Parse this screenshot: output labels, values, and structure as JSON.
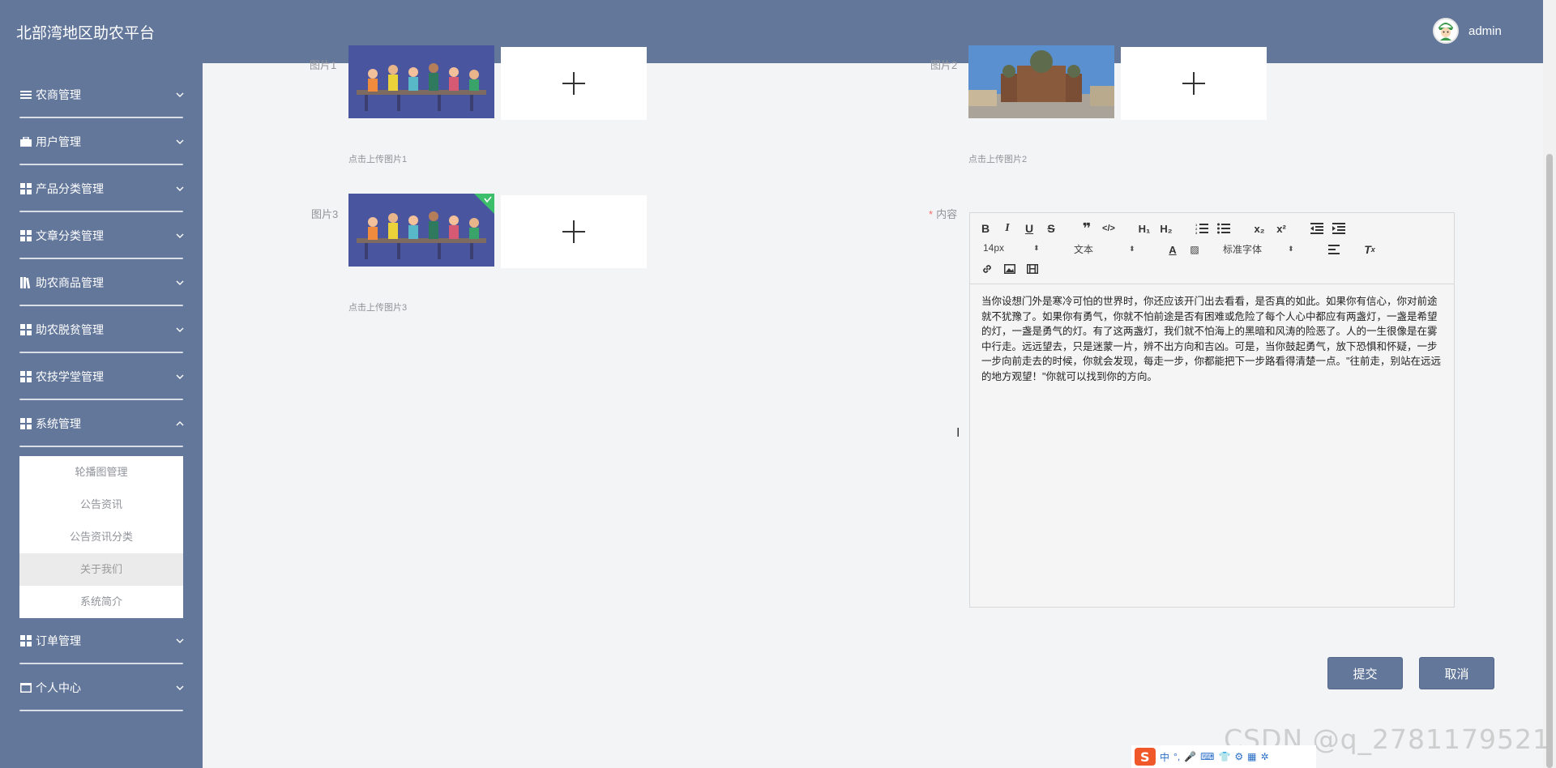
{
  "header": {
    "title": "北部湾地区助农平台",
    "user": "admin"
  },
  "sidebar": {
    "items": [
      {
        "label": "农商管理",
        "icon": "list-icon"
      },
      {
        "label": "用户管理",
        "icon": "briefcase-icon"
      },
      {
        "label": "产品分类管理",
        "icon": "grid-icon"
      },
      {
        "label": "文章分类管理",
        "icon": "grid-icon"
      },
      {
        "label": "助农商品管理",
        "icon": "books-icon"
      },
      {
        "label": "助农脱贫管理",
        "icon": "grid-icon"
      },
      {
        "label": "农技学堂管理",
        "icon": "grid-icon"
      },
      {
        "label": "系统管理",
        "icon": "grid-icon"
      },
      {
        "label": "订单管理",
        "icon": "grid-icon"
      },
      {
        "label": "个人中心",
        "icon": "window-icon"
      }
    ],
    "system_submenu": [
      "轮播图管理",
      "公告资讯",
      "公告资讯分类",
      "关于我们",
      "系统简介"
    ]
  },
  "form": {
    "image1_label": "图片1",
    "image1_hint": "点击上传图片1",
    "image2_label": "图片2",
    "image2_hint": "点击上传图片2",
    "image3_label": "图片3",
    "image3_hint": "点击上传图片3",
    "content_label": "内容",
    "content_required": "*"
  },
  "editor": {
    "font_size": "14px",
    "text_type": "文本",
    "font_family": "标准字体",
    "content": "当你设想门外是寒冷可怕的世界时，你还应该开门出去看看，是否真的如此。如果你有信心，你对前途就不犹豫了。如果你有勇气，你就不怕前途是否有困难或危险了每个人心中都应有两盏灯，一盏是希望的灯，一盏是勇气的灯。有了这两盏灯，我们就不怕海上的黑暗和风涛的险恶了。人的一生很像是在雾中行走。远远望去，只是迷蒙一片，辨不出方向和吉凶。可是，当你鼓起勇气，放下恐惧和怀疑，一步一步向前走去的时候，你就会发现，每走一步，你都能把下一步路看得清楚一点。\"往前走，别站在远远的地方观望！\"你就可以找到你的方向。"
  },
  "buttons": {
    "submit": "提交",
    "cancel": "取消"
  },
  "overlay": {
    "watermark": "CSDN @q_2781179521",
    "ime_label": "中"
  },
  "colors": {
    "primary": "#63779b",
    "background": "#f3f4f6"
  }
}
